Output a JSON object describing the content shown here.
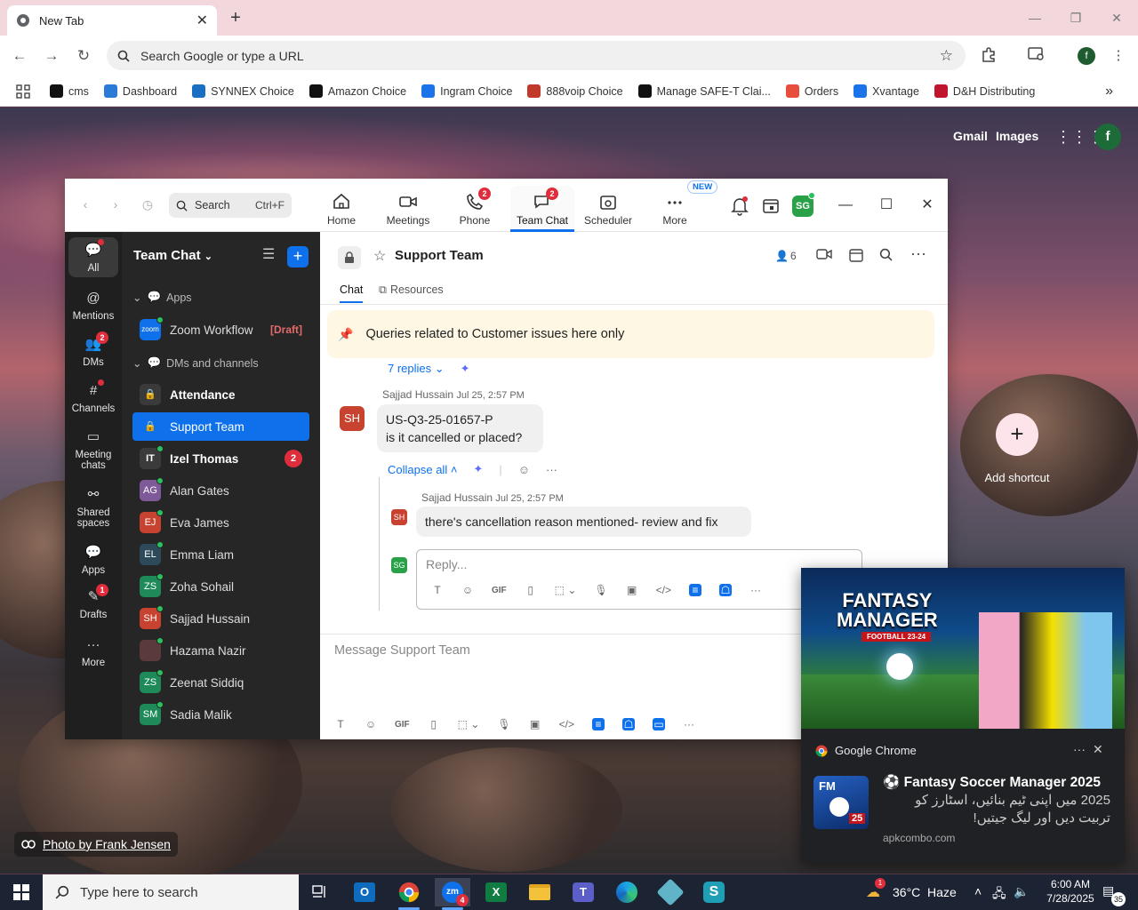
{
  "browser": {
    "tab_title": "New Tab",
    "omnibox_placeholder": "Search Google or type a URL",
    "profile_letter": "f",
    "bookmarks": [
      {
        "label": "cms",
        "color": "#111111"
      },
      {
        "label": "Dashboard",
        "color": "#2b7bd6"
      },
      {
        "label": "SYNNEX Choice",
        "color": "#1a6fc2"
      },
      {
        "label": "Amazon Choice",
        "color": "#111111"
      },
      {
        "label": "Ingram Choice",
        "color": "#1a73e8"
      },
      {
        "label": "888voip Choice",
        "color": "#c0392b"
      },
      {
        "label": "Manage SAFE-T Clai...",
        "color": "#111111"
      },
      {
        "label": "Orders",
        "color": "#e74c3c"
      },
      {
        "label": "Xvantage",
        "color": "#1a73e8"
      },
      {
        "label": "D&H Distributing",
        "color": "#c0152d"
      }
    ]
  },
  "newtab": {
    "gmail": "Gmail",
    "images": "Images",
    "account_letter": "f",
    "add_shortcut": "Add shortcut",
    "photo_credit": "Photo by Frank Jensen"
  },
  "zoom": {
    "search_label": "Search",
    "search_shortcut": "Ctrl+F",
    "tabs": [
      {
        "label": "Home",
        "icon": "home-icon"
      },
      {
        "label": "Meetings",
        "icon": "video-icon"
      },
      {
        "label": "Phone",
        "icon": "phone-icon",
        "badge": "2"
      },
      {
        "label": "Team Chat",
        "icon": "chat-icon",
        "badge": "2"
      },
      {
        "label": "Scheduler",
        "icon": "calendar-icon"
      },
      {
        "label": "More",
        "icon": "more-icon",
        "tag": "NEW"
      }
    ],
    "avatar_initials": "SG",
    "rail": [
      {
        "label": "All"
      },
      {
        "label": "Mentions"
      },
      {
        "label": "DMs",
        "badge": "2"
      },
      {
        "label": "Channels"
      },
      {
        "label": "Meeting chats"
      },
      {
        "label": "Shared spaces"
      },
      {
        "label": "Apps"
      },
      {
        "label": "Drafts",
        "badge": "1"
      },
      {
        "label": "More"
      }
    ],
    "list": {
      "title": "Team Chat",
      "section_apps": "Apps",
      "section_dms": "DMs and channels",
      "items": [
        {
          "label": "Zoom Workflow",
          "tail": "[Draft]"
        },
        {
          "label": "Attendance"
        },
        {
          "label": "Support Team"
        },
        {
          "label": "Izel Thomas",
          "initials": "IT",
          "count": "2"
        },
        {
          "label": "Alan Gates",
          "initials": "AG"
        },
        {
          "label": "Eva James",
          "initials": "EJ"
        },
        {
          "label": "Emma Liam",
          "initials": "EL"
        },
        {
          "label": "Zoha Sohail",
          "initials": "ZS"
        },
        {
          "label": "Sajjad Hussain",
          "initials": "SH"
        },
        {
          "label": "Hazama Nazir",
          "initials": ""
        },
        {
          "label": "Zeenat Siddiq",
          "initials": "ZS"
        },
        {
          "label": "Sadia Malik",
          "initials": "SM"
        }
      ]
    },
    "chat": {
      "channel_name": "Support Team",
      "member_count": "6",
      "tab_chat": "Chat",
      "tab_resources": "Resources",
      "pinned": "Queries related to Customer issues here only",
      "replies_link": "7 replies",
      "msg1": {
        "initials": "SH",
        "author": "Sajjad Hussain",
        "time": "Jul 25, 2:57 PM",
        "line1": "US-Q3-25-01657-P",
        "line2": "is it cancelled or placed?"
      },
      "collapse_all": "Collapse all",
      "msg2": {
        "initials": "SH",
        "author": "Sajjad Hussain",
        "time": "Jul 25, 2:57 PM",
        "text": "there's cancellation reason mentioned- review and fix"
      },
      "reply_initials": "SG",
      "reply_placeholder": "Reply...",
      "composer_placeholder": "Message Support Team",
      "gif": "GIF"
    }
  },
  "notification": {
    "app": "Google Chrome",
    "promo_title_1": "FANTASY",
    "promo_title_2": "MANAGER",
    "promo_sub": "FOOTBALL 23-24",
    "icon_text": "FM",
    "icon_num": "25",
    "title": "Fantasy Soccer Manager 2025",
    "body": "2025 میں اپنی ٹیم بنائیں، اسٹارز کو تربیت دیں اور لیگ جیتیں!",
    "source": "apkcombo.com"
  },
  "taskbar": {
    "search_placeholder": "Type here to search",
    "zoom_badge": "4",
    "weather": "36°C  Haze",
    "weather_badge": "1",
    "time": "6:00 AM",
    "date": "7/28/2025",
    "notif_count": "35"
  }
}
